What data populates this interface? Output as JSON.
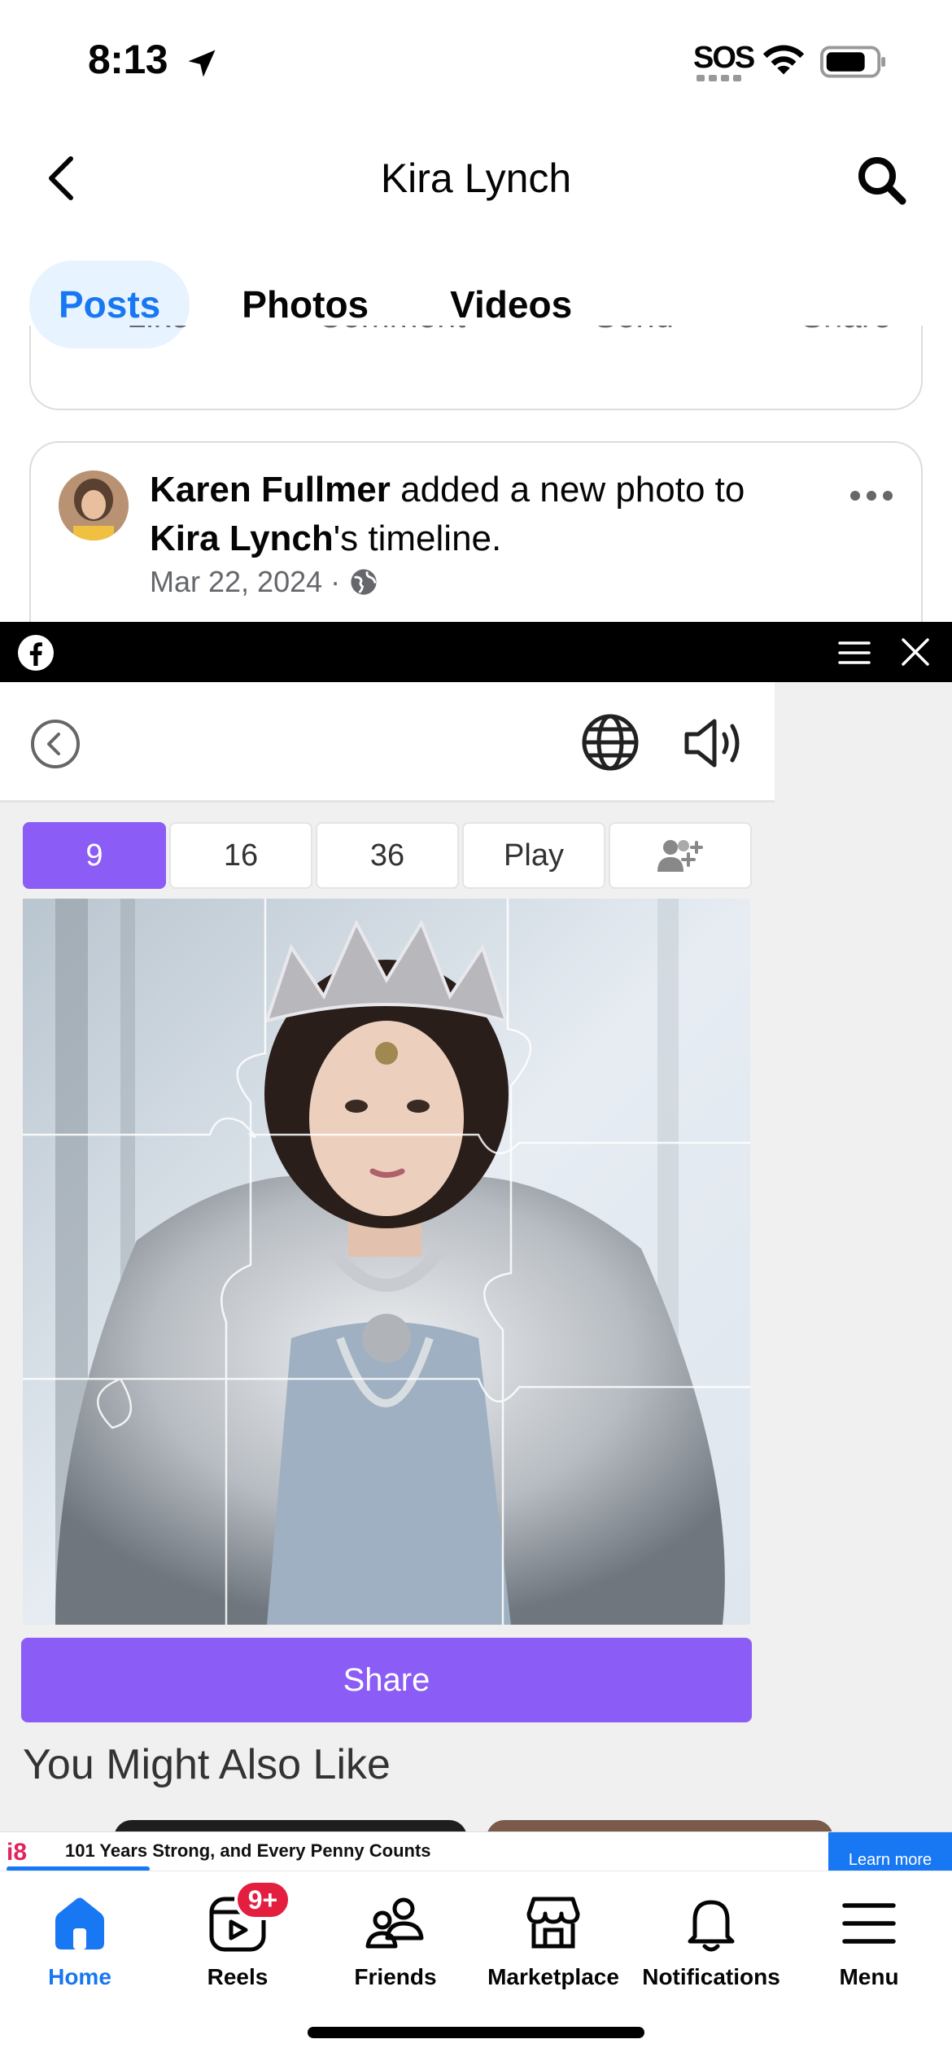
{
  "status": {
    "time": "8:13",
    "sos": "SOS"
  },
  "header": {
    "title": "Kira Lynch"
  },
  "tabs": [
    "Posts",
    "Photos",
    "Videos"
  ],
  "post_actions": [
    "Like",
    "Comment",
    "Send",
    "Share"
  ],
  "post": {
    "author": "Karen Fullmer",
    "action_text": " added a new photo to ",
    "target": "Kira Lynch",
    "target_suffix": "'s timeline.",
    "date": "Mar 22, 2024 ·"
  },
  "game": {
    "modes": [
      "9",
      "16",
      "36",
      "Play"
    ],
    "active_mode": "9",
    "share_label": "Share",
    "also_like": "You Might Also Like"
  },
  "ad": {
    "logo": "i8",
    "headline": "101 Years Strong, and Every Penny Counts",
    "cta": "Learn more"
  },
  "nav": {
    "items": [
      "Home",
      "Reels",
      "Friends",
      "Marketplace",
      "Notifications",
      "Menu"
    ],
    "reels_badge": "9+"
  },
  "colors": {
    "facebook_blue": "#1877f2",
    "game_purple": "#8b5cf6",
    "badge_red": "#e41e3f"
  }
}
